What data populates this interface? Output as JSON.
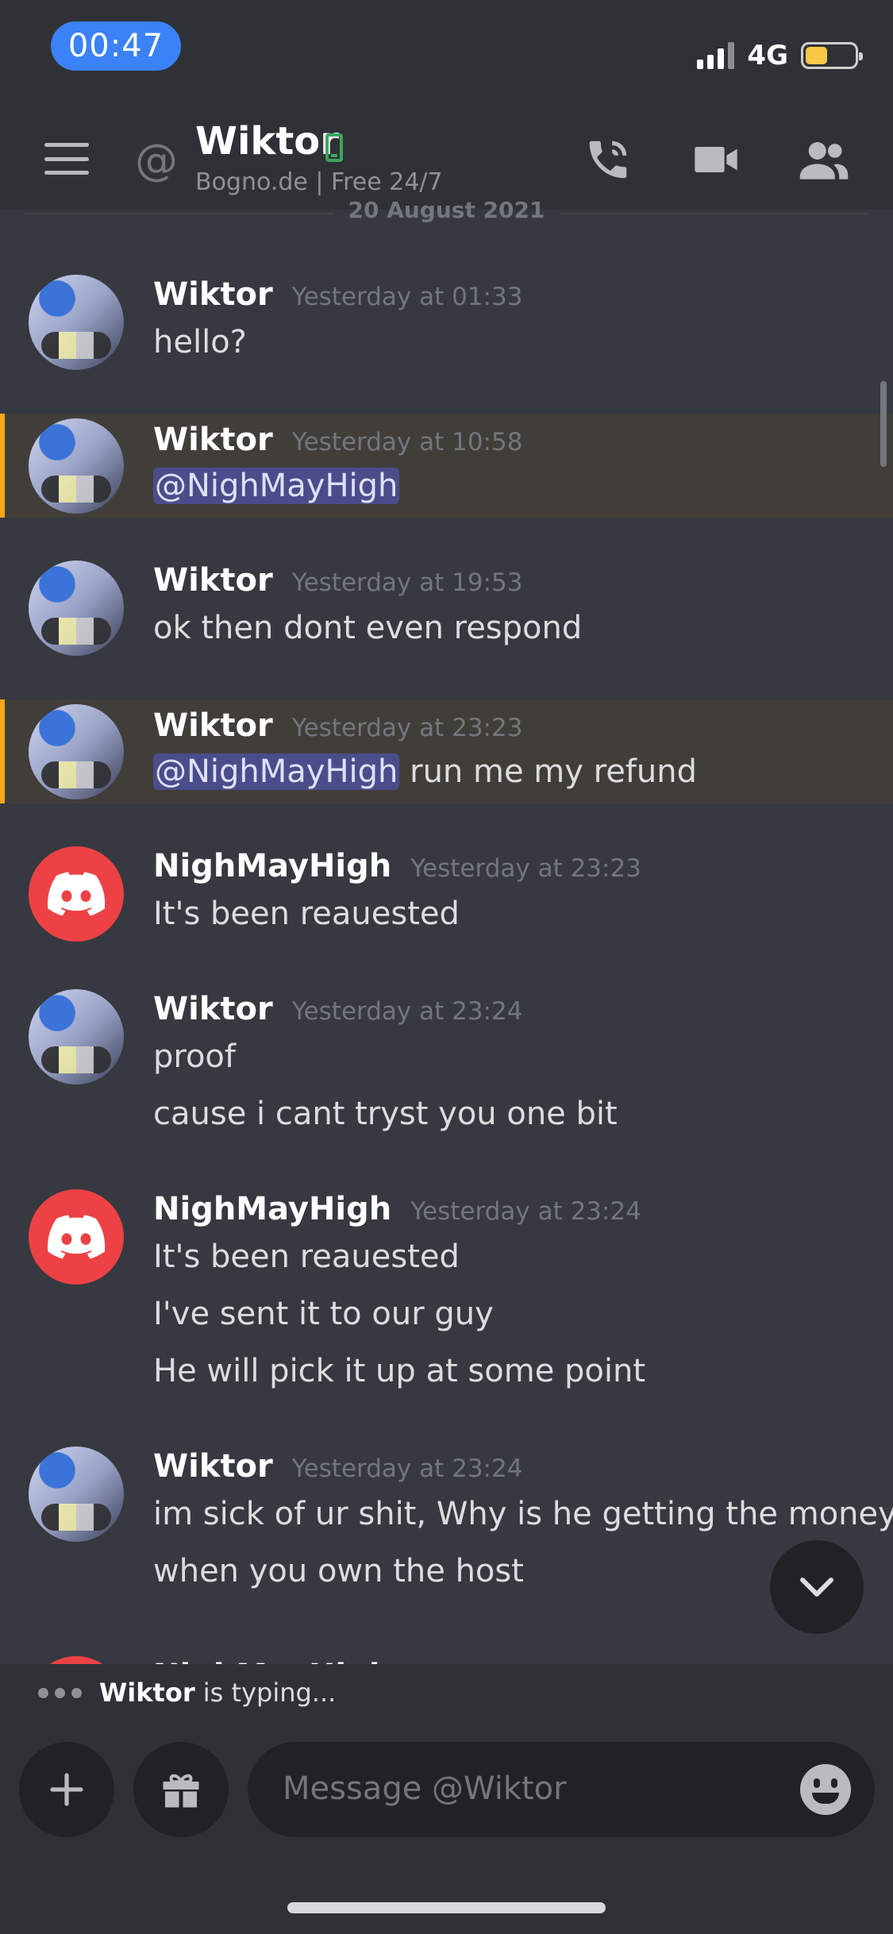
{
  "status_bar": {
    "time": "00:47",
    "network": "4G",
    "battery_level": 0.45
  },
  "header": {
    "title": "Wiktor",
    "subtitle": "Bogno.de  | Free 24/7",
    "icons": [
      "menu-icon",
      "at-icon",
      "mobile-status-icon",
      "call-icon",
      "video-icon",
      "members-icon"
    ]
  },
  "date_divider": "20 August 2021",
  "messages": [
    {
      "author": "Wiktor",
      "timestamp": "Yesterday at 01:33",
      "lines": [
        "hello?"
      ]
    },
    {
      "author": "Wiktor",
      "timestamp": "Yesterday at 10:58",
      "mention": "@NighMayHigh",
      "lines": [
        ""
      ]
    },
    {
      "author": "Wiktor",
      "timestamp": "Yesterday at 19:53",
      "lines": [
        "ok then dont even respond"
      ]
    },
    {
      "author": "Wiktor",
      "timestamp": "Yesterday at 23:23",
      "mention": "@NighMayHigh",
      "lines": [
        "run me my refund"
      ]
    },
    {
      "author": "NighMayHigh",
      "timestamp": "Yesterday at 23:23",
      "lines": [
        "It's been reauested"
      ]
    },
    {
      "author": "Wiktor",
      "timestamp": "Yesterday at 23:24",
      "lines": [
        "proof",
        "cause i cant tryst you one bit"
      ]
    },
    {
      "author": "NighMayHigh",
      "timestamp": "Yesterday at 23:24",
      "lines": [
        "It's been reauested",
        "I've sent it to our guy",
        "He will pick it up at some point"
      ]
    },
    {
      "author": "Wiktor",
      "timestamp": "Yesterday at 23:24",
      "lines": [
        "im sick of ur shit, Why is he getting the money",
        "when you own the host"
      ]
    },
    {
      "author": "NighMayHigh",
      "timestamp": "",
      "lines": []
    }
  ],
  "typing": {
    "user": "Wiktor",
    "suffix": "is typing..."
  },
  "composer": {
    "placeholder": "Message @Wiktor"
  },
  "colors": {
    "background": "#36393f",
    "header": "#2f3136",
    "mention_highlight": "#faa61a",
    "discord_red": "#ed4245",
    "online_green": "#3ba55d"
  }
}
